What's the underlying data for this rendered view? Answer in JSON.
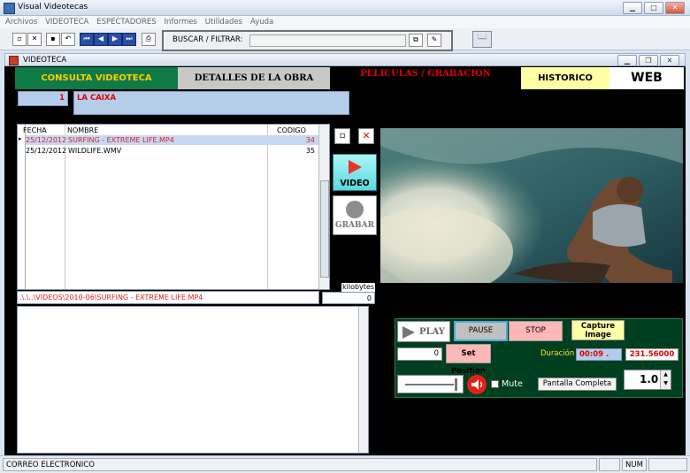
{
  "window": {
    "title": "Visual Videotecas"
  },
  "menu": [
    "Archivos",
    "VIDEOTECA",
    "ESPECTADORES",
    "Informes",
    "Utilidades",
    "Ayuda"
  ],
  "toolbar": {
    "search_label": "BUSCAR / FILTRAR:",
    "search_value": ""
  },
  "mdi": {
    "title": "VIDEOTECA"
  },
  "tabs": [
    {
      "label": "CONSULTA VIDEOTECA",
      "color": "#ffcc00",
      "bg": "#0f7a45"
    },
    {
      "label": "DETALLES DE LA OBRA",
      "color": "#000000",
      "bg": "#c8c8c8"
    },
    {
      "label": "PELICULAS / GRABACION",
      "color": "#e00000",
      "bg": "#000000"
    },
    {
      "label": "HISTORICO",
      "color": "#000000",
      "bg": "#ffffa6"
    },
    {
      "label": "WEB",
      "color": "#000000",
      "bg": "#ffffff"
    }
  ],
  "record": {
    "number": "1",
    "name": "LA CAIXA"
  },
  "files": {
    "columns": [
      "FECHA",
      "NOMBRE",
      "CODIGO"
    ],
    "rows": [
      {
        "fecha": "25/12/2012",
        "nombre": "SURFING - EXTREME LIFE.MP4",
        "codigo": "34",
        "selected": true
      },
      {
        "fecha": "25/12/2012",
        "nombre": "WILDLIFE.WMV",
        "codigo": "35",
        "selected": false
      }
    ],
    "path": ".\\.\\..\\VIDEOS\\2010-06\\SURFING - EXTREME LIFE.MP4",
    "kilobytes_label": "kilobytes",
    "kilobytes_value": "0"
  },
  "side": {
    "video_label": "VIDEO",
    "grabar_label": "GRABAR"
  },
  "player": {
    "play": "PLAY",
    "pause": "PAUSE",
    "stop": "STOP",
    "capture": "Capture Image",
    "position_value": "0",
    "set_position": "Set Position",
    "duracion_label": "Duración",
    "time_value": "00:09",
    "time_dot": ".",
    "total_value": "231.56000",
    "mute": "Mute",
    "fullscreen": "Pantalla Completa",
    "speed": "1.0"
  },
  "status": {
    "left": "CORREO ELECTRONICO",
    "num": "NUM"
  }
}
